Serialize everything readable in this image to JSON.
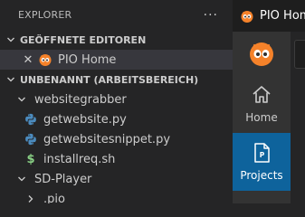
{
  "explorer": {
    "title": "EXPLORER",
    "more_icon": "more-actions-icon",
    "open_editors": {
      "title": "GEÖFFNETE EDITOREN",
      "items": [
        {
          "label": "PIO Home",
          "icon": "platformio-icon"
        }
      ]
    },
    "workspace": {
      "title": "UNBENANNT (ARBEITSBEREICH)",
      "tree": [
        {
          "label": "websitegrabber",
          "type": "folder",
          "expanded": true
        },
        {
          "label": "getwebsite.py",
          "type": "python"
        },
        {
          "label": "getwebsitesnippet.py",
          "type": "python"
        },
        {
          "label": "installreq.sh",
          "type": "shell",
          "icon_text": "$"
        },
        {
          "label": "SD-Player",
          "type": "folder",
          "expanded": true
        },
        {
          "label": ".pio",
          "type": "folder",
          "expanded": false
        }
      ]
    }
  },
  "editor": {
    "active_tab": "PIO Home"
  },
  "pio_home": {
    "nav": [
      {
        "label": "Home",
        "icon": "home-icon",
        "active": false
      },
      {
        "label": "Projects",
        "icon": "project-file-icon",
        "active": true
      }
    ]
  },
  "colors": {
    "sidebar_bg": "#252526",
    "editor_bg": "#1e1e1e",
    "pio_nav_bg": "#333333",
    "active_nav": "#0e639c",
    "pio_orange": "#f5822a",
    "python_blue": "#4b8bbe",
    "shell_green": "#89d185"
  }
}
